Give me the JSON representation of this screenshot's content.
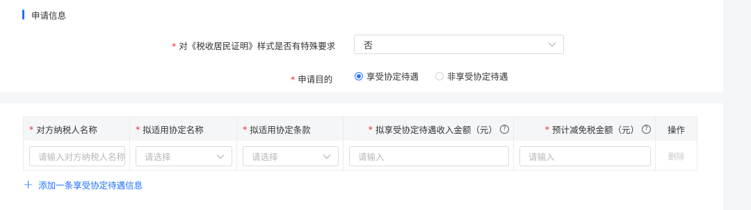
{
  "section": {
    "title": "申请信息"
  },
  "form": {
    "special_requirement": {
      "label": "对《税收居民证明》样式是否有特殊要求",
      "value": "否"
    },
    "purpose": {
      "label": "申请目的",
      "options": [
        {
          "label": "享受协定待遇",
          "selected": true
        },
        {
          "label": "非享受协定待遇",
          "selected": false
        }
      ]
    }
  },
  "table": {
    "headers": {
      "counterparty_name": "对方纳税人名称",
      "treaty_name": "拟适用协定名称",
      "treaty_clause": "拟适用协定条款",
      "income_amount": "拟享受协定待遇收入金额（元）",
      "tax_reduction": "预计减免税金额（元）",
      "action": "操作"
    },
    "row": {
      "counterparty_placeholder": "请输入对方纳税人名称",
      "treaty_name_placeholder": "请选择",
      "treaty_clause_placeholder": "请选择",
      "income_placeholder": "请输入",
      "reduction_placeholder": "请输入",
      "delete_label": "删除"
    }
  },
  "add_row_label": "添加一条享受协定待遇信息",
  "colors": {
    "accent": "#1e6fff",
    "required": "#f5222d"
  },
  "icons": {
    "dropdown": "chevron-down-icon",
    "help": "question-circle-icon",
    "add": "plus-icon"
  }
}
